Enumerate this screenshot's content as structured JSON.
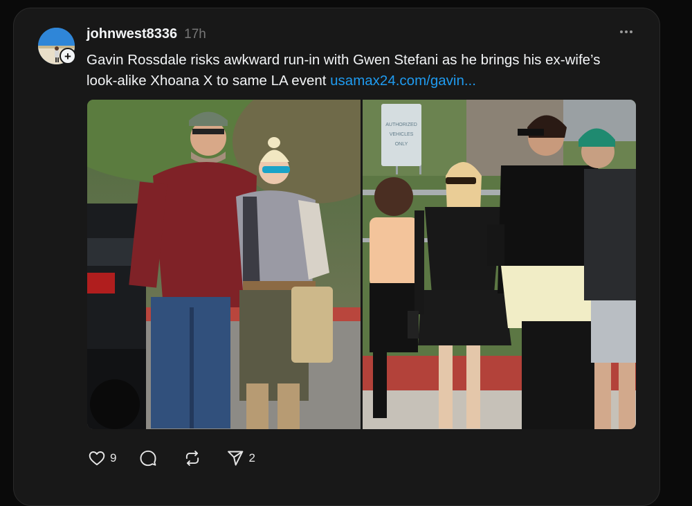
{
  "post": {
    "username": "johnwest8336",
    "timestamp": "17h",
    "text": "Gavin Rossdale risks awkward run-in with Gwen Stefani as he brings his ex-wife’s look-alike Xhoana X to same LA event ",
    "link": "usamax24.com/gavin..."
  },
  "photos": {
    "right_sign": [
      "AUTHORIZED",
      "VEHICLES",
      "ONLY"
    ]
  },
  "actions": {
    "like_count": "9",
    "share_count": "2"
  },
  "icons": {
    "follow": "plus-icon",
    "more": "more-horizontal-icon",
    "like": "heart-icon",
    "comment": "comment-icon",
    "repost": "repost-icon",
    "share": "send-icon"
  },
  "colors": {
    "background": "#0a0a0a",
    "card": "#181818",
    "link": "#1f9bf0",
    "muted": "#777777"
  }
}
